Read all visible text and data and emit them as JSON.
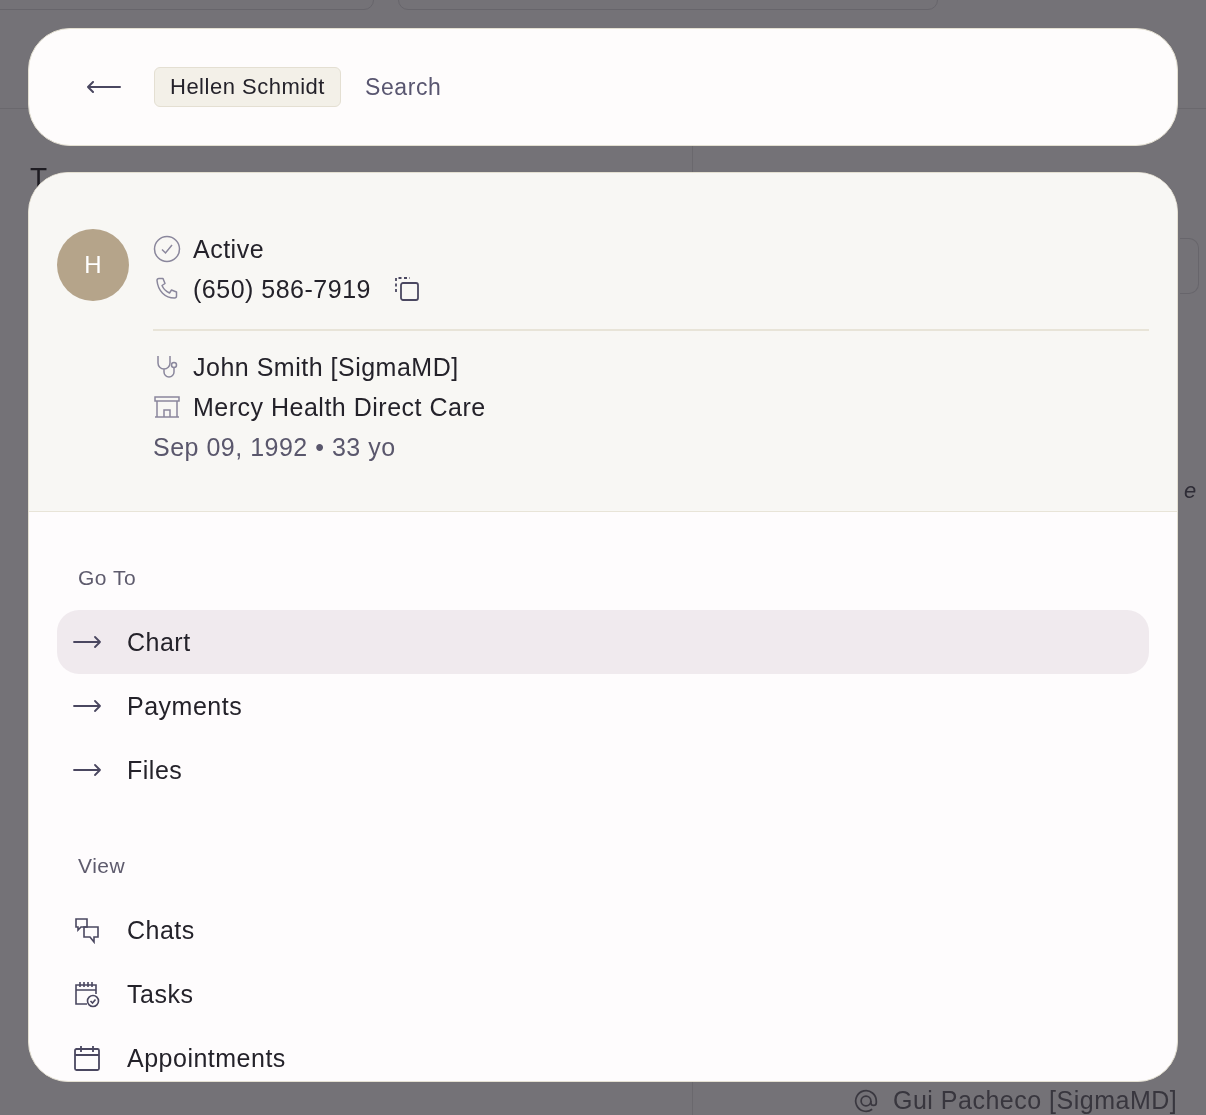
{
  "background": {
    "heading": "T",
    "side_text": "e",
    "footer_user": "Gui Pacheco [SigmaMD]"
  },
  "search": {
    "chip": "Hellen Schmidt",
    "placeholder": "Search"
  },
  "patient": {
    "initial": "H",
    "status": "Active",
    "phone": "(650) 586-7919",
    "provider": "John Smith [SigmaMD]",
    "clinic": "Mercy Health Direct Care",
    "dob": "Sep 09, 1992 • 33 yo"
  },
  "sections": [
    {
      "title": "Go To",
      "items": [
        {
          "label": "Chart",
          "kind": "goto",
          "selected": true
        },
        {
          "label": "Payments",
          "kind": "goto",
          "selected": false
        },
        {
          "label": "Files",
          "kind": "goto",
          "selected": false
        }
      ]
    },
    {
      "title": "View",
      "items": [
        {
          "label": "Chats",
          "kind": "chats",
          "selected": false
        },
        {
          "label": "Tasks",
          "kind": "tasks",
          "selected": false
        },
        {
          "label": "Appointments",
          "kind": "appointments",
          "selected": false
        }
      ]
    }
  ]
}
